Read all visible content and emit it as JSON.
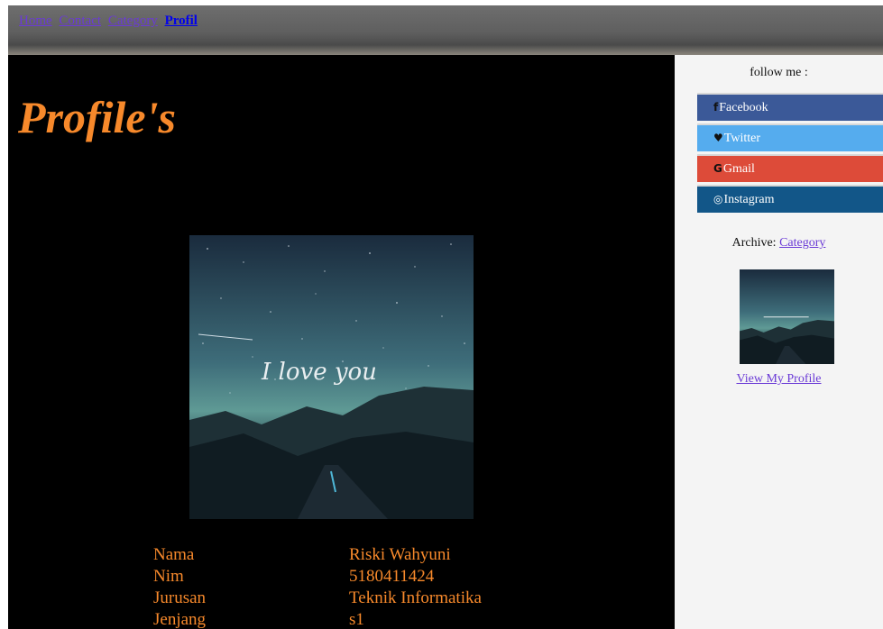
{
  "nav": {
    "links": [
      "Home",
      "Contact",
      "Category",
      "Profil"
    ]
  },
  "main": {
    "title": "Profile's",
    "photo_caption": "I love you",
    "info": [
      {
        "key": "Nama",
        "value": "Riski Wahyuni"
      },
      {
        "key": "Nim",
        "value": "5180411424"
      },
      {
        "key": "Jurusan",
        "value": "Teknik Informatika"
      },
      {
        "key": "Jenjang",
        "value": "s1"
      }
    ]
  },
  "sidebar": {
    "follow_label": "follow me :",
    "social": [
      {
        "icon": "f",
        "label": "Facebook",
        "color": "#3b5998"
      },
      {
        "icon": "♥",
        "label": "Twitter",
        "color": "#55acee"
      },
      {
        "icon": "G",
        "label": "Gmail",
        "color": "#dd4b39"
      },
      {
        "icon": "◎",
        "label": "Instagram",
        "color": "#125688"
      }
    ],
    "archive_label": "Archive:",
    "archive_link": "Category",
    "view_profile": "View My Profile"
  },
  "colors": {
    "accent": "#f7892b",
    "link_visited": "#6a3ad6",
    "link_active": "#0000ee"
  }
}
